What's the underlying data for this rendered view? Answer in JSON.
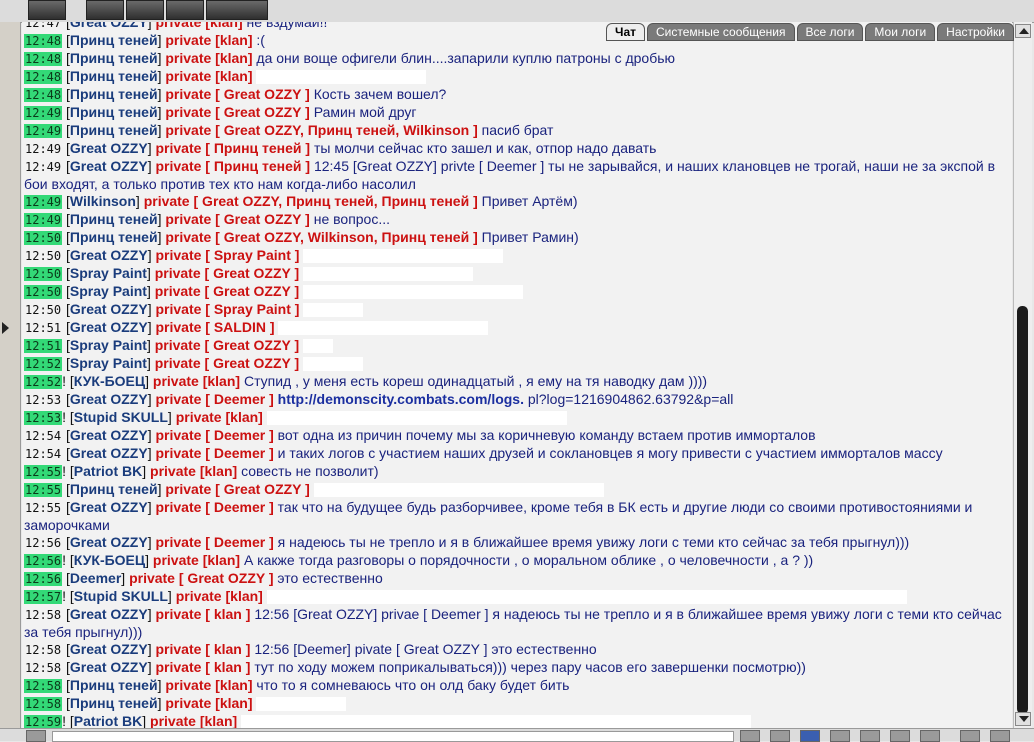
{
  "tabs": [
    "Чат",
    "Системные сообщения",
    "Все логи",
    "Мои логи",
    "Настройки"
  ],
  "active_tab": "Чат",
  "private_label": "private",
  "messages": [
    {
      "time": "12:47",
      "hl": false,
      "pre": "",
      "name": "Great OZZY",
      "rcpt": "klan",
      "bracket": "[klan]",
      "text": "не вздумай!!",
      "hidden": 0
    },
    {
      "time": "12:48",
      "hl": true,
      "pre": "",
      "name": "Принц теней",
      "rcpt": "klan",
      "bracket": "[klan]",
      "text": ":(",
      "hidden": 0
    },
    {
      "time": "12:48",
      "hl": true,
      "pre": "",
      "name": "Принц теней",
      "rcpt": "klan",
      "bracket": "[klan]",
      "text": "да они воще офигели блин....запарили куплю патроны с дробью",
      "hidden": 0
    },
    {
      "time": "12:48",
      "hl": true,
      "pre": "",
      "name": "Принц теней",
      "rcpt": "klan",
      "bracket": "[klan]",
      "text": "",
      "hidden": 170
    },
    {
      "time": "12:48",
      "hl": true,
      "pre": "",
      "name": "Принц теней",
      "rcpt": "Great OZZY",
      "bracket": "[ Great OZZY ]",
      "text": "Кость зачем вошел?",
      "hidden": 0
    },
    {
      "time": "12:49",
      "hl": true,
      "pre": "",
      "name": "Принц теней",
      "rcpt": "Great OZZY",
      "bracket": "[ Great OZZY ]",
      "text": "Рамин мой друг",
      "hidden": 0
    },
    {
      "time": "12:49",
      "hl": true,
      "pre": "",
      "name": "Принц теней",
      "rcpt": "Great OZZY, Принц теней, Wilkinson",
      "bracket": "[ Great OZZY, Принц теней, Wilkinson ]",
      "text": "пасиб брат",
      "hidden": 0
    },
    {
      "time": "12:49",
      "hl": false,
      "pre": "",
      "name": "Great OZZY",
      "rcpt": "Принц теней",
      "bracket": "[ Принц теней ]",
      "text": "ты молчи сейчас кто зашел и как, отпор надо давать",
      "hidden": 0
    },
    {
      "time": "12:49",
      "hl": false,
      "pre": "",
      "name": "Great OZZY",
      "rcpt": "Принц теней",
      "bracket": "[ Принц теней ]",
      "text": "12:45 [Great OZZY] privte [ Deemer ] ты не зарывайся, и наших клановцев не трогай, наши не за экспой в бои входят, а только против тех кто нам когда-либо насолил",
      "hidden": 0
    },
    {
      "time": "12:49",
      "hl": true,
      "pre": "",
      "name": "Wilkinson",
      "rcpt": "Great OZZY, Принц теней, Принц теней",
      "bracket": "[ Great OZZY, Принц теней, Принц теней ]",
      "text": "Привет Артём)",
      "hidden": 0
    },
    {
      "time": "12:49",
      "hl": true,
      "pre": "",
      "name": "Принц теней",
      "rcpt": "Great OZZY",
      "bracket": "[ Great OZZY ]",
      "text": "не вопрос...",
      "hidden": 0
    },
    {
      "time": "12:50",
      "hl": true,
      "pre": "",
      "name": "Принц теней",
      "rcpt": "Great OZZY, Wilkinson, Принц теней",
      "bracket": "[ Great OZZY, Wilkinson, Принц теней ]",
      "text": "Привет Рамин)",
      "hidden": 0
    },
    {
      "time": "12:50",
      "hl": false,
      "pre": "",
      "name": "Great OZZY",
      "rcpt": "Spray Paint",
      "bracket": "[ Spray Paint ]",
      "text": "",
      "hidden": 200
    },
    {
      "time": "12:50",
      "hl": true,
      "pre": "",
      "name": "Spray Paint",
      "rcpt": "Great OZZY",
      "bracket": "[ Great OZZY ]",
      "text": "",
      "hidden": 170
    },
    {
      "time": "12:50",
      "hl": true,
      "pre": "",
      "name": "Spray Paint",
      "rcpt": "Great OZZY",
      "bracket": "[ Great OZZY ]",
      "text": "",
      "hidden": 220
    },
    {
      "time": "12:50",
      "hl": false,
      "pre": "",
      "name": "Great OZZY",
      "rcpt": "Spray Paint",
      "bracket": "[ Spray Paint ]",
      "text": "",
      "hidden": 60
    },
    {
      "time": "12:51",
      "hl": false,
      "pre": "",
      "name": "Great OZZY",
      "rcpt": "SALDIN",
      "bracket": "[ SALDIN ]",
      "text": "",
      "hidden": 210
    },
    {
      "time": "12:51",
      "hl": true,
      "pre": "",
      "name": "Spray Paint",
      "rcpt": "Great OZZY",
      "bracket": "[ Great OZZY ]",
      "text": "",
      "hidden": 30
    },
    {
      "time": "12:52",
      "hl": true,
      "pre": "",
      "name": "Spray Paint",
      "rcpt": "Great OZZY",
      "bracket": "[ Great OZZY ]",
      "text": "",
      "hidden": 60
    },
    {
      "time": "12:52",
      "hl": true,
      "pre": "!",
      "name": "КУК-БОЕЦ",
      "rcpt": "klan",
      "bracket": "[klan]",
      "text": "Ступид , у меня есть кореш одинадцатый , я ему на тя наводку дам ))))",
      "hidden": 0
    },
    {
      "time": "12:53",
      "hl": false,
      "pre": "",
      "name": "Great OZZY",
      "rcpt": "Deemer",
      "bracket": "[ Deemer ]",
      "text": "",
      "url": "http://demonscity.combats.com/logs.",
      "url_tail": "pl?log=1216904862.63792&p=all",
      "hidden": 0
    },
    {
      "time": "12:53",
      "hl": true,
      "pre": "!",
      "name": "Stupid SKULL",
      "rcpt": "klan",
      "bracket": "[klan]",
      "text": "",
      "hidden": 300
    },
    {
      "time": "12:54",
      "hl": false,
      "pre": "",
      "name": "Great OZZY",
      "rcpt": "Deemer",
      "bracket": "[ Deemer ]",
      "text": "вот одна из причин почему мы за коричневую команду встаем против имморталов",
      "hidden": 0
    },
    {
      "time": "12:54",
      "hl": false,
      "pre": "",
      "name": "Great OZZY",
      "rcpt": "Deemer",
      "bracket": "[ Deemer ]",
      "text": "и таких логов с участием наших друзей и соклановцев я могу привести с участием имморталов массу",
      "hidden": 0
    },
    {
      "time": "12:55",
      "hl": true,
      "pre": "!",
      "name": "Patriot BK",
      "rcpt": "klan",
      "bracket": "[klan]",
      "text": "совесть не позволит)",
      "hidden": 0
    },
    {
      "time": "12:55",
      "hl": true,
      "pre": "",
      "name": "Принц теней",
      "rcpt": "Great OZZY",
      "bracket": "[ Great OZZY ]",
      "text": "",
      "hidden": 290
    },
    {
      "time": "12:55",
      "hl": false,
      "pre": "",
      "name": "Great OZZY",
      "rcpt": "Deemer",
      "bracket": "[ Deemer ]",
      "text": "так что на будущее будь разборчивее, кроме тебя в БК есть и другие люди со своими противостояниями и заморочками",
      "hidden": 0
    },
    {
      "time": "12:56",
      "hl": false,
      "pre": "",
      "name": "Great OZZY",
      "rcpt": "Deemer",
      "bracket": "[ Deemer ]",
      "text": "я надеюсь ты не трепло и я в ближайшее время увижу логи с теми кто сейчас за тебя прыгнул)))",
      "hidden": 0
    },
    {
      "time": "12:56",
      "hl": true,
      "pre": "!",
      "name": "КУК-БОЕЦ",
      "rcpt": "klan",
      "bracket": "[klan]",
      "text": "А какже тогда разговоры о порядочности , о моральном облике , о человечности , а ? ))",
      "hidden": 0
    },
    {
      "time": "12:56",
      "hl": true,
      "pre": "",
      "name": "Deemer",
      "rcpt": "Great OZZY",
      "bracket": "[ Great OZZY ]",
      "text": "это естественно",
      "hidden": 0
    },
    {
      "time": "12:57",
      "hl": true,
      "pre": "!",
      "name": "Stupid SKULL",
      "rcpt": "klan",
      "bracket": "[klan]",
      "text": "",
      "hidden": 640
    },
    {
      "time": "12:58",
      "hl": false,
      "pre": "",
      "name": "Great OZZY",
      "rcpt": "klan",
      "bracket": "[ klan ]",
      "text": "12:56 [Great OZZY] privae [ Deemer ] я надеюсь ты не трепло и я в ближайшее время увижу логи с теми кто сейчас за тебя прыгнул)))",
      "hidden": 0
    },
    {
      "time": "12:58",
      "hl": false,
      "pre": "",
      "name": "Great OZZY",
      "rcpt": "klan",
      "bracket": "[ klan ]",
      "text": "12:56 [Deemer] pivate [ Great OZZY ] это естественно",
      "hidden": 0
    },
    {
      "time": "12:58",
      "hl": false,
      "pre": "",
      "name": "Great OZZY",
      "rcpt": "klan",
      "bracket": "[ klan ]",
      "text": "тут по ходу можем поприкалываться))) через пару часов его завершенки посмотрю))",
      "hidden": 0
    },
    {
      "time": "12:58",
      "hl": true,
      "pre": "",
      "name": "Принц теней",
      "rcpt": "klan",
      "bracket": "[klan]",
      "text": "что то я сомневаюсь что он олд баку будет бить",
      "hidden": 0
    },
    {
      "time": "12:58",
      "hl": true,
      "pre": "",
      "name": "Принц теней",
      "rcpt": "klan",
      "bracket": "[klan]",
      "text": "",
      "hidden": 90
    },
    {
      "time": "12:59",
      "hl": true,
      "pre": "!",
      "name": "Patriot BK",
      "rcpt": "klan",
      "bracket": "[klan]",
      "text": "",
      "hidden": 510
    }
  ]
}
